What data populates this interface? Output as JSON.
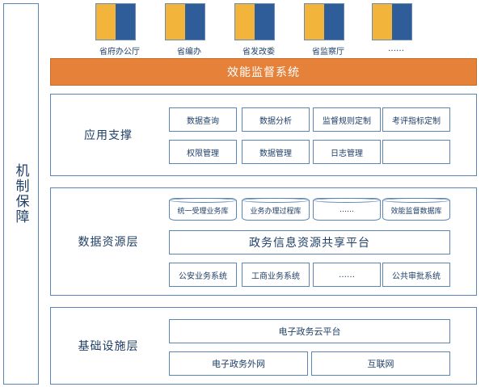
{
  "side_label": "机制保障",
  "departments": [
    {
      "label": "省府办公厅",
      "icon": "people-group-icon"
    },
    {
      "label": "省编办",
      "icon": "people-group-icon"
    },
    {
      "label": "省发改委",
      "icon": "people-group-icon"
    },
    {
      "label": "省监察厅",
      "icon": "people-group-icon"
    },
    {
      "label": "……",
      "icon": "people-group-icon"
    }
  ],
  "supervision_bar": "效能监督系统",
  "layers": {
    "application": {
      "label": "应用支撑",
      "row1": [
        "数据查询",
        "数据分析",
        "监督规则定制",
        "考评指标定制"
      ],
      "row2": [
        "权限管理",
        "数据管理",
        "日志管理",
        ""
      ]
    },
    "data": {
      "label": "数据资源层",
      "databases": [
        "统一受理业务库",
        "业务办理过程库",
        "……",
        "效能监督数据库"
      ],
      "platform": "政务信息资源共享平台",
      "systems": [
        "公安业务系统",
        "工商业务系统",
        "……",
        "公共审批系统"
      ]
    },
    "infrastructure": {
      "label": "基础设施层",
      "cloud": "电子政务云平台",
      "networks": [
        "电子政务外网",
        "互联网"
      ]
    }
  },
  "colors": {
    "accent_orange": "#e6813a",
    "border_blue": "#5b85b5",
    "icon_blue": "#2e5d9a",
    "icon_yellow": "#f2b43a"
  }
}
